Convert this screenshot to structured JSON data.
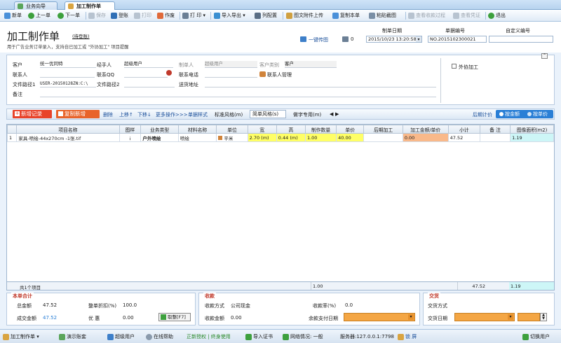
{
  "tabs": [
    {
      "label": "业务向导"
    },
    {
      "label": "加工制作单"
    }
  ],
  "toolbar": {
    "new": "新单",
    "prev": "上一单",
    "next": "下一单",
    "save": "保存",
    "login": "登账",
    "print_disabled": "打印",
    "void": "作废",
    "print": "打 印",
    "import_export": "导入导出",
    "col_config": "列配置",
    "attach": "图文附件上传",
    "copy": "复制本单",
    "paste": "粘贴截图",
    "view_pay": "查看收款过程",
    "view_voucher": "查看凭证",
    "exit": "退出"
  },
  "header": {
    "title": "加工制作单",
    "status": "(待登账)",
    "subtitle": "用于广告业务订单录入，支持自已加工或 \"外协加工\" 项目提醒",
    "one_key_pass": "一键传图",
    "print_count": "0",
    "date_label": "制单日期",
    "date_value": "2015/10/23 13:20:58",
    "no_label": "单据编号",
    "no_value": "NO.2015102300021",
    "custom_label": "自定义编号",
    "custom_value": ""
  },
  "info": {
    "customer_label": "客户",
    "customer_value": "统一优同特",
    "handler_label": "经手人",
    "handler_value": "超级用户",
    "maker_label": "制单人",
    "maker_value": "超级用户",
    "cust_type_label": "客户类别",
    "cust_type_value": "客户",
    "contact_label": "联系人",
    "contact_value": "",
    "qq_label": "联系QQ",
    "qq_value": "",
    "phone_label": "联系电话",
    "phone_value": "",
    "contact_mgmt": "联系人管理",
    "path1_label": "文件路径1",
    "path1_value": "USER-20150128ZN:C:\\",
    "path2_label": "文件路径2",
    "path2_value": "",
    "address_label": "送货地址",
    "address_value": "",
    "remark_label": "备注",
    "remark_value": "",
    "outsource": "外协加工"
  },
  "gridbar": {
    "add": "新增记录",
    "copy_add": "复制新增",
    "delete": "删除",
    "up": "上移↑",
    "down": "下移↓",
    "more": "更多操作>>>",
    "style": "单据样式",
    "std_style": "标准风格(m)",
    "simple_style": "简单风格(s)",
    "special": "做字专用(m)",
    "later_price": "后期计价",
    "by_amount": "按金额",
    "by_unit": "按单价"
  },
  "grid": {
    "columns": [
      "项目名称",
      "图样",
      "业务类型",
      "材料名称",
      "单位",
      "宽",
      "高",
      "制作数量",
      "单价",
      "后期加工",
      "加工金额/单价",
      "小计",
      "备 注",
      "图像面积(m2)"
    ],
    "rows": [
      {
        "idx": "1",
        "name": "家具-喷绘-44x270cm -1张.tif",
        "pattern": "¡",
        "biz": "户外喷绘",
        "material": "喷绘",
        "unit": "平米",
        "width": "2.70 (m)",
        "height": "0.44 (m)",
        "qty": "1.00",
        "price": "40.00",
        "later": "",
        "proc": "0.00",
        "subtotal": "47.52",
        "note": "",
        "area": "1.19"
      }
    ],
    "summary_count": "共1个项目",
    "summary_qty": "1.00",
    "summary_subtotal": "47.52",
    "summary_area": "1.19"
  },
  "totals": {
    "title": "本单合计",
    "total_label": "总金额",
    "total_value": "47.52",
    "discount_label": "整单折扣(%)",
    "discount_value": "100.0",
    "deal_label": "成交金额",
    "deal_value": "47.52",
    "rebate_label": "优 惠",
    "rebate_value": "0.00",
    "round_btn": "取整[F7]"
  },
  "payment": {
    "title": "收款",
    "method_label": "收款方式",
    "method_value": "公司现金",
    "rate_label": "收款率(%)",
    "rate_value": "0.0",
    "amount_label": "收款金额",
    "amount_value": "0.00",
    "due_label": "余款支付日期",
    "due_value": ""
  },
  "delivery": {
    "title": "交货",
    "method_label": "交货方式",
    "method_value": "",
    "date_label": "交货日期",
    "date_value": ""
  },
  "status": {
    "module": "加工制作单",
    "demo": "演示账套",
    "user": "超级用户",
    "help": "在线帮助",
    "license": "正新授权 | 终身使用",
    "import_cert": "导入证书",
    "network": "网络情况: 一般",
    "server": "服务器:127.0.0.1:7798",
    "lock": "锁 屏",
    "switch_user": "切换用户"
  },
  "colors": {
    "accent_red": "#e8432a",
    "accent_blue": "#2a7fd6",
    "yellow": "#ffff66",
    "orange": "#f9b98a",
    "cyan": "#cdf6f7"
  }
}
